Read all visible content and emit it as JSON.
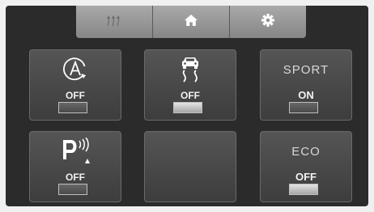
{
  "topbar": {
    "buttons": [
      {
        "name": "defrost",
        "icon": "heat-waves-icon",
        "enabled": false
      },
      {
        "name": "home",
        "icon": "home-icon",
        "enabled": true
      },
      {
        "name": "settings",
        "icon": "gear-icon",
        "enabled": true
      }
    ]
  },
  "tiles": {
    "auto_start_stop": {
      "icon": "auto-start-stop-icon",
      "state": "OFF",
      "indicator_on": false
    },
    "traction_control": {
      "icon": "skid-car-icon",
      "state": "OFF",
      "indicator_on": true
    },
    "sport": {
      "label": "SPORT",
      "state": "ON",
      "indicator_on": false
    },
    "park_assist": {
      "icon": "parking-sensor-icon",
      "state": "OFF",
      "indicator_on": false
    },
    "empty": {},
    "eco": {
      "label": "ECO",
      "state": "OFF",
      "indicator_on": true
    }
  },
  "colors": {
    "background": "#2b2b2b",
    "tile": "#4a4a4a",
    "text": "#f2f2f2",
    "indicator_lit": "#d0d0d0"
  }
}
